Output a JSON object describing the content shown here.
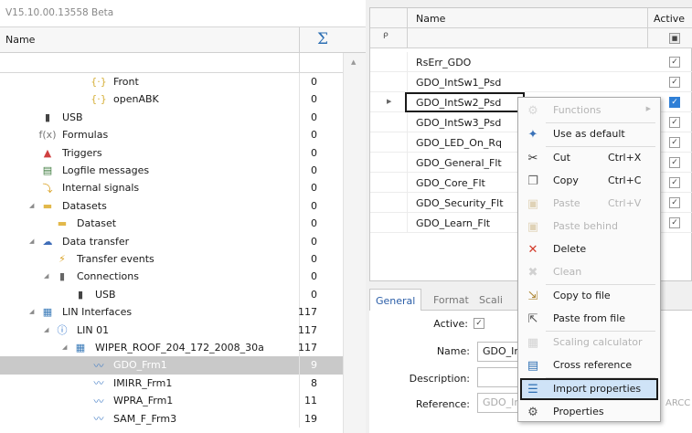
{
  "app": {
    "version": "V15.10.00.13558 Beta"
  },
  "tree": {
    "col_name": "Name",
    "col_sum_icon": "sigma-icon",
    "rows": [
      {
        "label": "Front",
        "count": "0",
        "icon": "brace-icon",
        "depth": 4
      },
      {
        "label": "openABK",
        "count": "0",
        "icon": "brace-icon",
        "depth": 4
      },
      {
        "label": "USB",
        "count": "0",
        "icon": "usb-icon",
        "depth": 1
      },
      {
        "label": "Formulas",
        "count": "0",
        "icon": "formula-icon",
        "depth": 1
      },
      {
        "label": "Triggers",
        "count": "0",
        "icon": "trigger-icon",
        "depth": 1
      },
      {
        "label": "Logfile messages",
        "count": "0",
        "icon": "logfile-icon",
        "depth": 1
      },
      {
        "label": "Internal signals",
        "count": "0",
        "icon": "signals-icon",
        "depth": 1
      },
      {
        "label": "Datasets",
        "count": "0",
        "icon": "folder-icon",
        "depth": 1,
        "expanded": true
      },
      {
        "label": "Dataset",
        "count": "0",
        "icon": "folder-icon",
        "depth": 2
      },
      {
        "label": "Data transfer",
        "count": "0",
        "icon": "cloud-icon",
        "depth": 1,
        "expanded": true
      },
      {
        "label": "Transfer events",
        "count": "0",
        "icon": "transfer-event-icon",
        "depth": 2
      },
      {
        "label": "Connections",
        "count": "0",
        "icon": "connection-icon",
        "depth": 2,
        "expanded": true
      },
      {
        "label": "USB",
        "count": "0",
        "icon": "usb-icon",
        "depth": 3
      },
      {
        "label": "LIN Interfaces",
        "count": "117",
        "icon": "lin-icon",
        "depth": 1,
        "expanded": true
      },
      {
        "label": "LIN 01",
        "count": "117",
        "icon": "lin-info-icon",
        "depth": 2,
        "expanded": true
      },
      {
        "label": "WIPER_ROOF_204_172_2008_30a",
        "count": "117",
        "icon": "lin-icon",
        "depth": 3,
        "expanded": true
      },
      {
        "label": "GDO_Frm1",
        "count": "9",
        "icon": "frame-icon",
        "depth": 4,
        "selected": true
      },
      {
        "label": "IMIRR_Frm1",
        "count": "8",
        "icon": "frame-icon",
        "depth": 4
      },
      {
        "label": "WPRA_Frm1",
        "count": "11",
        "icon": "frame-icon",
        "depth": 4
      },
      {
        "label": "SAM_F_Frm3",
        "count": "19",
        "icon": "frame-icon",
        "depth": 4
      }
    ]
  },
  "grid": {
    "col_name": "Name",
    "col_active": "Active",
    "rows": [
      {
        "name": "RsErr_GDO",
        "active": true
      },
      {
        "name": "GDO_IntSw1_Psd",
        "active": true
      },
      {
        "name": "GDO_IntSw2_Psd",
        "active": true,
        "editing": true,
        "selected": true
      },
      {
        "name": "GDO_IntSw3_Psd",
        "active": true
      },
      {
        "name": "GDO_LED_On_Rq",
        "active": true
      },
      {
        "name": "GDO_General_Flt",
        "active": true
      },
      {
        "name": "GDO_Core_Flt",
        "active": true
      },
      {
        "name": "GDO_Security_Flt",
        "active": true
      },
      {
        "name": "GDO_Learn_Flt",
        "active": true
      }
    ]
  },
  "props": {
    "tabs": [
      "General",
      "Format",
      "Scali"
    ],
    "active_label": "Active:",
    "active_checked": true,
    "name_label": "Name:",
    "name_value": "GDO_In",
    "description_label": "Description:",
    "description_value": "",
    "reference_label": "Reference:",
    "reference_value": "GDO_In",
    "reference_tail": "ARCC"
  },
  "context_menu": {
    "items": [
      {
        "label": "Functions",
        "icon": "functions-icon",
        "disabled": true,
        "submenu": true
      },
      {
        "label": "Use as default",
        "icon": "use-default-icon"
      },
      {
        "label": "Cut",
        "shortcut": "Ctrl+X",
        "icon": "scissors-icon"
      },
      {
        "label": "Copy",
        "shortcut": "Ctrl+C",
        "icon": "copy-icon"
      },
      {
        "label": "Paste",
        "shortcut": "Ctrl+V",
        "icon": "paste-icon",
        "disabled": true
      },
      {
        "label": "Paste behind",
        "icon": "paste-behind-icon",
        "disabled": true
      },
      {
        "label": "Delete",
        "icon": "delete-x-icon"
      },
      {
        "label": "Clean",
        "icon": "clean-icon",
        "disabled": true
      },
      {
        "label": "Copy to file",
        "icon": "copy-to-file-icon"
      },
      {
        "label": "Paste from file",
        "icon": "paste-from-file-icon"
      },
      {
        "label": "Scaling calculator",
        "icon": "calculator-icon",
        "disabled": true
      },
      {
        "label": "Cross reference",
        "icon": "cross-reference-icon"
      },
      {
        "label": "Import properties",
        "icon": "import-properties-icon",
        "highlighted": true
      },
      {
        "label": "Properties",
        "icon": "gear-icon"
      }
    ]
  }
}
